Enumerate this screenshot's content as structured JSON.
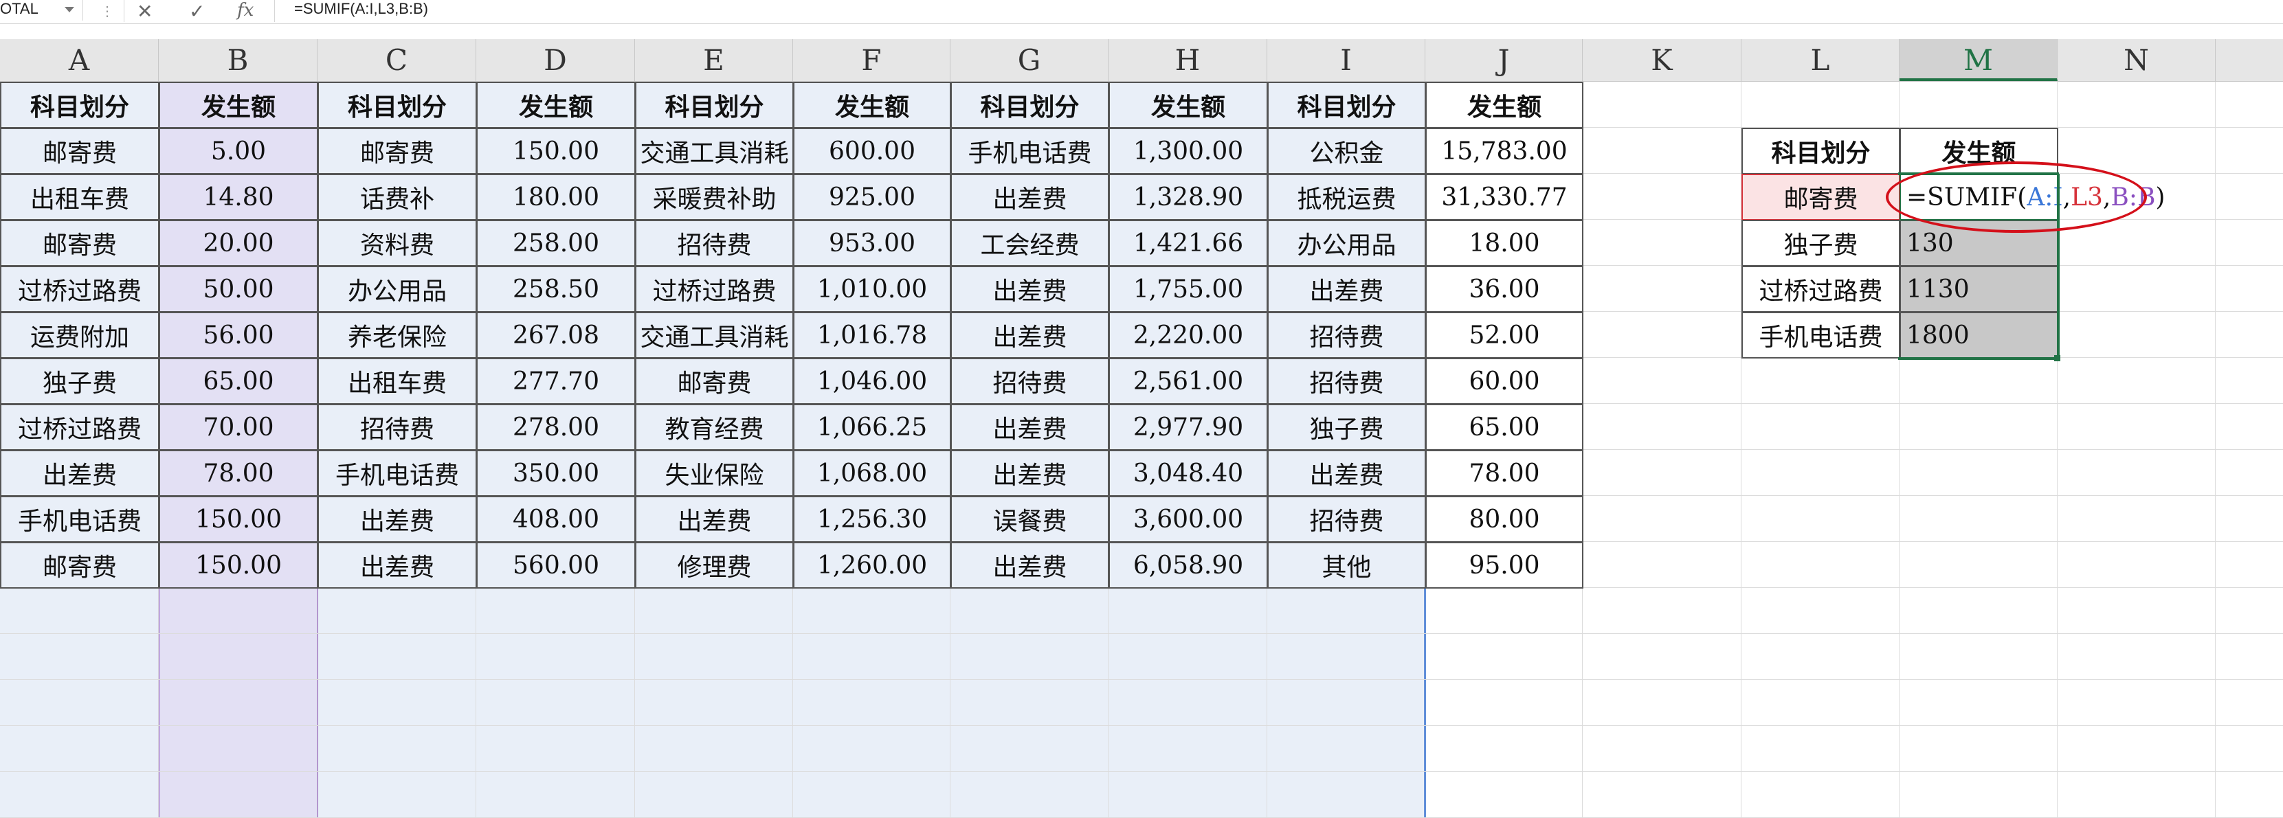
{
  "formula_bar": {
    "name_box": "OTAL",
    "cancel_icon": "close-icon",
    "enter_icon": "check-icon",
    "fx_label": "fx",
    "formula": "=SUMIF(A:I,L3,B:B)"
  },
  "columns": [
    "A",
    "B",
    "C",
    "D",
    "E",
    "F",
    "G",
    "H",
    "I",
    "J",
    "K",
    "L",
    "M",
    "N"
  ],
  "active_column": "M",
  "main_table": {
    "headers": [
      "科目划分",
      "发生额",
      "科目划分",
      "发生额",
      "科目划分",
      "发生额",
      "科目划分",
      "发生额",
      "科目划分",
      "发生额"
    ],
    "rows": [
      [
        "邮寄费",
        "5.00",
        "邮寄费",
        "150.00",
        "交通工具消耗",
        "600.00",
        "手机电话费",
        "1,300.00",
        "公积金",
        "15,783.00"
      ],
      [
        "出租车费",
        "14.80",
        "话费补",
        "180.00",
        "采暖费补助",
        "925.00",
        "出差费",
        "1,328.90",
        "抵税运费",
        "31,330.77"
      ],
      [
        "邮寄费",
        "20.00",
        "资料费",
        "258.00",
        "招待费",
        "953.00",
        "工会经费",
        "1,421.66",
        "办公用品",
        "18.00"
      ],
      [
        "过桥过路费",
        "50.00",
        "办公用品",
        "258.50",
        "过桥过路费",
        "1,010.00",
        "出差费",
        "1,755.00",
        "出差费",
        "36.00"
      ],
      [
        "运费附加",
        "56.00",
        "养老保险",
        "267.08",
        "交通工具消耗",
        "1,016.78",
        "出差费",
        "2,220.00",
        "招待费",
        "52.00"
      ],
      [
        "独子费",
        "65.00",
        "出租车费",
        "277.70",
        "邮寄费",
        "1,046.00",
        "招待费",
        "2,561.00",
        "招待费",
        "60.00"
      ],
      [
        "过桥过路费",
        "70.00",
        "招待费",
        "278.00",
        "教育经费",
        "1,066.25",
        "出差费",
        "2,977.90",
        "独子费",
        "65.00"
      ],
      [
        "出差费",
        "78.00",
        "手机电话费",
        "350.00",
        "失业保险",
        "1,068.00",
        "出差费",
        "3,048.40",
        "出差费",
        "78.00"
      ],
      [
        "手机电话费",
        "150.00",
        "出差费",
        "408.00",
        "出差费",
        "1,256.30",
        "误餐费",
        "3,600.00",
        "招待费",
        "80.00"
      ],
      [
        "邮寄费",
        "150.00",
        "出差费",
        "560.00",
        "修理费",
        "1,260.00",
        "出差费",
        "6,058.90",
        "其他",
        "95.00"
      ]
    ]
  },
  "summary_table": {
    "headers": [
      "科目划分",
      "发生额"
    ],
    "rows": [
      [
        "邮寄费",
        ""
      ],
      [
        "独子费",
        "130"
      ],
      [
        "过桥过路费",
        "1130"
      ],
      [
        "手机电话费",
        "1800"
      ]
    ],
    "formula_parts": [
      "=SUMIF(",
      "A:I",
      ",",
      "L3",
      ",",
      "B:B",
      ")"
    ]
  },
  "colors": {
    "range_a_i": "#3c78d8",
    "ref_l3": "#d6323a",
    "range_b": "#8a4fc0",
    "annotation_oval": "#d4101a",
    "selection": "#217346"
  }
}
